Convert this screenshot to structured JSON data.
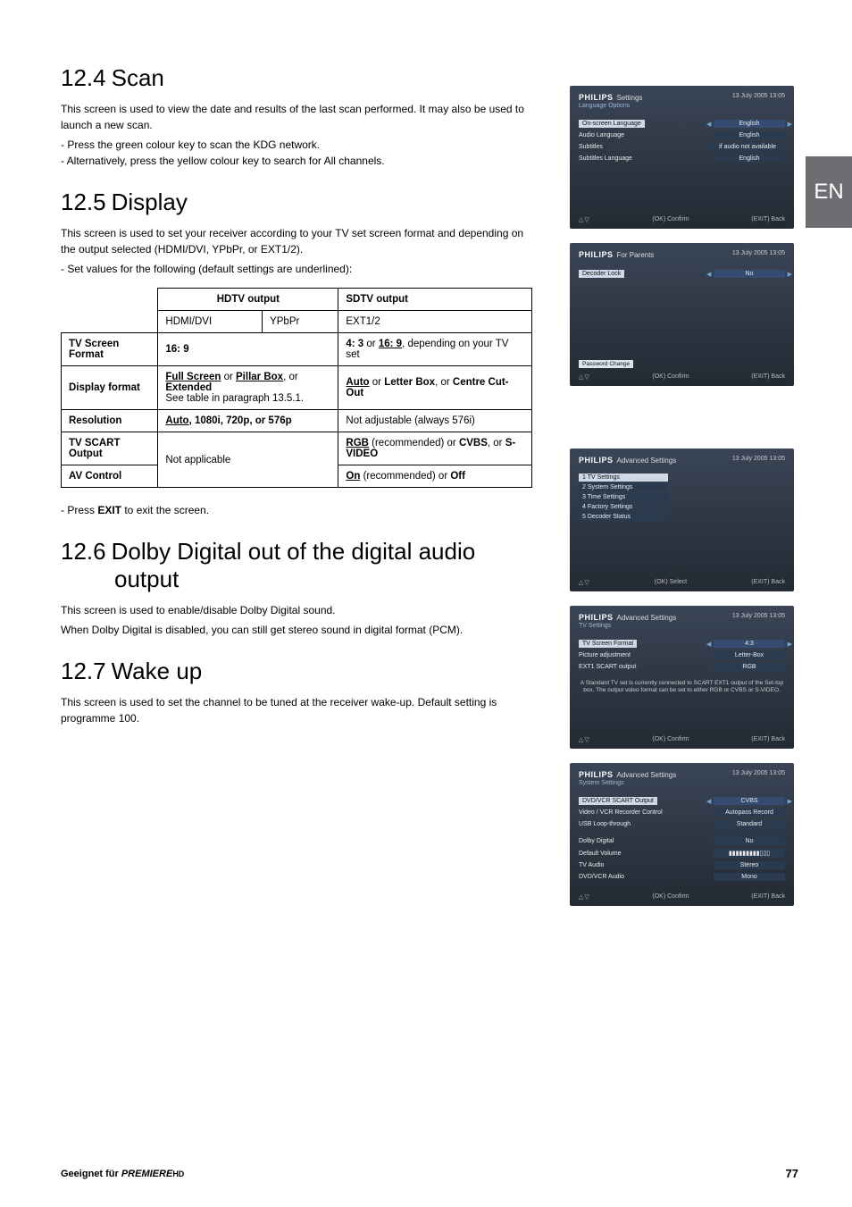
{
  "side_tab": "EN",
  "s124": {
    "heading_num": "12.4",
    "heading_text": "Scan",
    "p1": "This screen is used to view the date and results of the last scan performed. It may also be used to launch a new scan.",
    "li1": "-  Press the green colour key to scan the KDG network.",
    "li2": "-  Alternatively, press the yellow colour key to search for All channels."
  },
  "s125": {
    "heading_num": "12.5",
    "heading_text": "Display",
    "p1": "This screen is used to set your receiver according to your TV set screen format and depending on the output selected (HDMI/DVI, YPbPr, or EXT1/2).",
    "li1": "-  Set values for the following (default settings are underlined):",
    "table": {
      "h_hdtv": "HDTV output",
      "h_sdtv": "SDTV output",
      "h_hdmi": "HDMI/DVI",
      "h_ypbpr": "YPbPr",
      "h_ext": "EXT1/2",
      "r1_label": "TV Screen Format",
      "r1_hdtv": "16: 9",
      "r1_sdtv_a": "4: 3",
      "r1_sdtv_or": " or ",
      "r1_sdtv_b": "16: 9",
      "r1_sdtv_c": ", depending on your TV set",
      "r2_label": "Display format",
      "r2_hdtv_a": "Full Screen",
      "r2_hdtv_or1": " or ",
      "r2_hdtv_b": "Pillar Box",
      "r2_hdtv_or2": ", or ",
      "r2_hdtv_c": "Extended",
      "r2_hdtv_d": "See table in paragraph 13.5.1.",
      "r2_sdtv_a": "Auto",
      "r2_sdtv_or1": " or ",
      "r2_sdtv_b": "Letter Box",
      "r2_sdtv_or2": ", or ",
      "r2_sdtv_c": "Centre Cut-Out",
      "r3_label": "Resolution",
      "r3_hdtv_a": "Auto",
      "r3_hdtv_b": ", 1080i, 720p, or 576p",
      "r3_sdtv": "Not adjustable (always 576i)",
      "r4_label": "TV SCART Output",
      "r4_hdtv": "Not applicable",
      "r4_sdtv_a": "RGB",
      "r4_sdtv_b": " (recommended) or ",
      "r4_sdtv_c": "CVBS",
      "r4_sdtv_d": ", or ",
      "r4_sdtv_e": "S-VIDEO",
      "r5_label": "AV Control",
      "r5_sdtv_a": "On",
      "r5_sdtv_b": " (recommended) or ",
      "r5_sdtv_c": "Off"
    },
    "exit_a": "-  Press ",
    "exit_b": "EXIT",
    "exit_c": " to exit the screen."
  },
  "s126": {
    "heading_num": "12.6",
    "heading_text_a": "Dolby Digital out of the digital audio",
    "heading_text_b": "output",
    "p1": "This screen is used to enable/disable Dolby Digital sound.",
    "p2": "When Dolby Digital is disabled, you can still get stereo sound in digital format (PCM)."
  },
  "s127": {
    "heading_num": "12.7",
    "heading_text": "Wake up",
    "p1": "This screen is used to set the channel to be tuned at the receiver wake-up. Default setting is programme 100."
  },
  "footer": {
    "left_a": "Geeignet für ",
    "left_b": "PREMIERE",
    "left_c": "HD",
    "page": "77"
  },
  "thumbs": {
    "common": {
      "logo": "PHILIPS",
      "date": "13 July 2005   13:05",
      "confirm": "(OK) Confirm",
      "back": "(EXIT) Back",
      "select": "(OK) Select"
    },
    "t1": {
      "title": "Settings",
      "crumb": "Language Options",
      "rows": [
        {
          "lab": "On-screen Language",
          "val": "English",
          "sel": true
        },
        {
          "lab": "Audio Language",
          "val": "English"
        },
        {
          "lab": "Subtitles",
          "val": "if audio not available"
        },
        {
          "lab": "Subtitles Language",
          "val": "English"
        }
      ]
    },
    "t2": {
      "title": "For Parents",
      "rows": [
        {
          "lab": "Decoder Lock",
          "val": "No",
          "sel": true
        }
      ],
      "pw": "Password Change"
    },
    "t3": {
      "title": "Advanced Settings",
      "items": [
        "1  TV Settings",
        "2  System Settings",
        "3  Time Settings",
        "4  Factory Settings",
        "5  Decoder Status"
      ]
    },
    "t4": {
      "title": "Advanced Settings",
      "crumb": "TV Settings",
      "rows": [
        {
          "lab": "TV Screen Format",
          "val": "4:3",
          "sel": true
        },
        {
          "lab": "Picture adjustment",
          "val": "Letter-Box"
        },
        {
          "lab": "EXT1 SCART output",
          "val": "RGB"
        }
      ],
      "note": "A Standard TV set is currently connected to SCART EXT1 output of the Set-top box. The output video format can be set to either RGB or CVBS or S-VIDEO."
    },
    "t5": {
      "title": "Advanced Settings",
      "crumb": "System Settings",
      "rows": [
        {
          "lab": "DVD/VCR SCART Output",
          "val": "CVBS",
          "sel": true
        },
        {
          "lab": "Video / VCR Recorder Control",
          "val": "Autopass Record"
        },
        {
          "lab": "USB Loop-through",
          "val": "Standard"
        },
        {
          "lab": "",
          "val": ""
        },
        {
          "lab": "Dolby Digital",
          "val": "No"
        },
        {
          "lab": "Default Volume",
          "val": "▮▮▮▮▮▮▮▮▮▯▯▯"
        },
        {
          "lab": "TV Audio",
          "val": "Stereo"
        },
        {
          "lab": "DVD/VCR Audio",
          "val": "Mono"
        }
      ]
    }
  }
}
